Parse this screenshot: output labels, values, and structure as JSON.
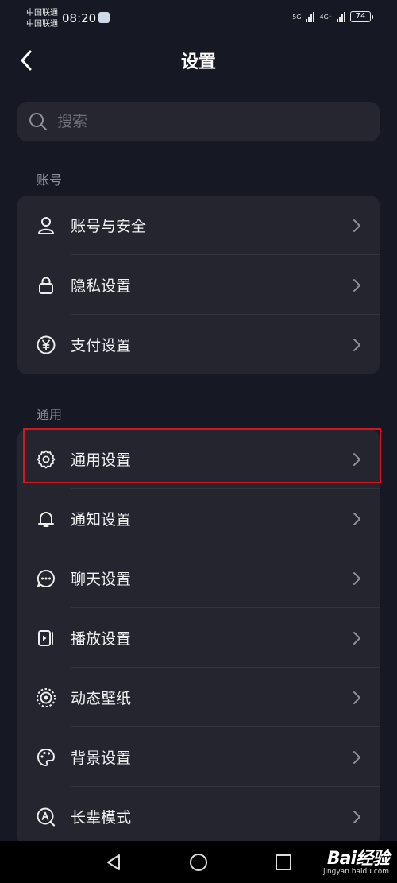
{
  "status_bar": {
    "carrier_1": "中国联通",
    "carrier_2": "中国联通",
    "time": "08:20",
    "network_1": "5G",
    "network_2": "4G⁺",
    "battery": "74"
  },
  "header": {
    "title": "设置",
    "back_icon": "chevron-left-icon"
  },
  "search": {
    "placeholder": "搜索",
    "value": ""
  },
  "sections": {
    "account": {
      "label": "账号",
      "items": [
        {
          "label": "账号与安全",
          "icon": "user-icon"
        },
        {
          "label": "隐私设置",
          "icon": "lock-icon"
        },
        {
          "label": "支付设置",
          "icon": "yen-icon"
        }
      ]
    },
    "general": {
      "label": "通用",
      "items": [
        {
          "label": "通用设置",
          "icon": "gear-icon"
        },
        {
          "label": "通知设置",
          "icon": "bell-icon"
        },
        {
          "label": "聊天设置",
          "icon": "chat-icon"
        },
        {
          "label": "播放设置",
          "icon": "play-icon"
        },
        {
          "label": "动态壁纸",
          "icon": "wallpaper-icon"
        },
        {
          "label": "背景设置",
          "icon": "palette-icon"
        },
        {
          "label": "长辈模式",
          "icon": "elder-mode-icon"
        }
      ]
    }
  },
  "highlight_color": "#d8141f",
  "watermark": {
    "brand": "Bai经验",
    "url": "jingyan.baidu.com"
  }
}
